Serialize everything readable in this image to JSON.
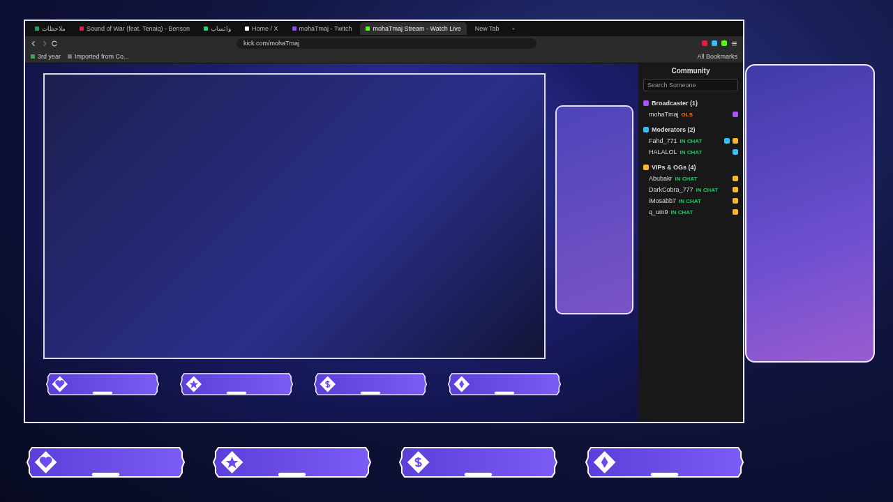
{
  "browser": {
    "tabs": [
      {
        "label": "ملاحظات",
        "kind": "sheet",
        "selected": false
      },
      {
        "label": "Sound of War (feat. Tenaiq) - Benson",
        "kind": "music",
        "selected": false
      },
      {
        "label": "واتساب",
        "kind": "chat",
        "selected": false
      },
      {
        "label": "Home / X",
        "kind": "x",
        "selected": false
      },
      {
        "label": "mohaTmaj - Twitch",
        "kind": "twitch",
        "selected": false
      },
      {
        "label": "mohaTmaj Stream - Watch Live",
        "kind": "kick",
        "selected": true
      },
      {
        "label": "New Tab",
        "kind": "plain",
        "selected": false
      }
    ],
    "new_tab": "+",
    "url": "kick.com/mohaTmaj",
    "bookmarks": [
      {
        "label": "3rd year",
        "kind": "drive"
      },
      {
        "label": "Imported from Co...",
        "kind": "folder"
      }
    ],
    "all_bookmarks": "All Bookmarks"
  },
  "community": {
    "title": "Community",
    "search": {
      "placeholder": "Search Someone"
    },
    "groups": [
      {
        "name": "Broadcaster (1)",
        "color": "#a855f7",
        "members": [
          {
            "name": "mohaTmaj",
            "status": "OLS",
            "badges": [
              {
                "kind": "broadcaster"
              }
            ]
          }
        ]
      },
      {
        "name": "Moderators (2)",
        "color": "#38bdf8",
        "members": [
          {
            "name": "Fahd_771",
            "status": "IN CHAT",
            "badges": [
              {
                "kind": "moderator"
              },
              {
                "kind": "vip"
              }
            ]
          },
          {
            "name": "HALALOL",
            "status": "IN CHAT",
            "badges": [
              {
                "kind": "moderator"
              }
            ]
          }
        ]
      },
      {
        "name": "VIPs & OGs (4)",
        "color": "#f5b82e",
        "members": [
          {
            "name": "Abubakr",
            "status": "IN CHAT",
            "badges": [
              {
                "kind": "vip"
              }
            ]
          },
          {
            "name": "DarkCobra_777",
            "status": "IN CHAT",
            "badges": [
              {
                "kind": "vip"
              }
            ]
          },
          {
            "name": "iMosabb7",
            "status": "IN CHAT",
            "badges": [
              {
                "kind": "vip"
              }
            ]
          },
          {
            "name": "q_um9",
            "status": "IN CHAT",
            "badges": [
              {
                "kind": "vip"
              }
            ]
          }
        ]
      }
    ]
  },
  "overlay": {
    "banners": [
      {
        "kind": "heart"
      },
      {
        "kind": "star"
      },
      {
        "kind": "dollar"
      },
      {
        "kind": "diamond"
      }
    ]
  }
}
